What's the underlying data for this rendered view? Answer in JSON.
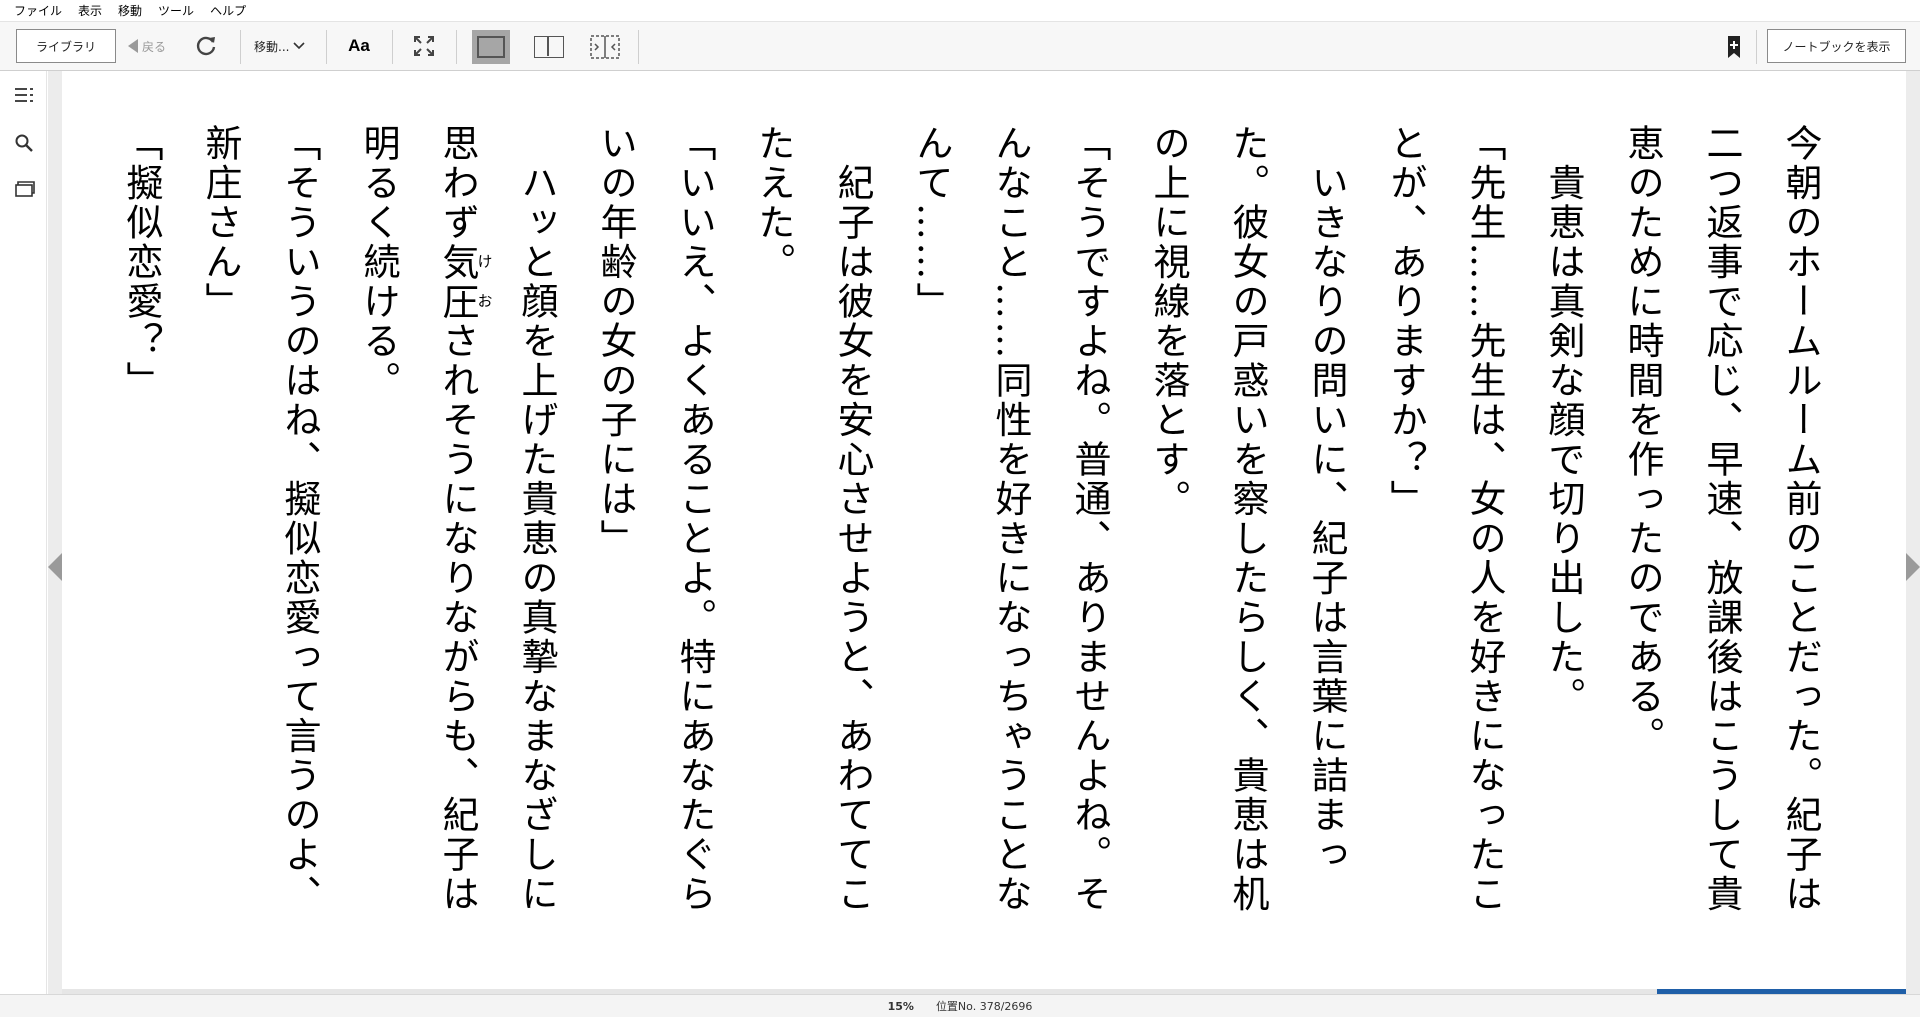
{
  "menu": [
    "ファイル",
    "表示",
    "移動",
    "ツール",
    "ヘルプ"
  ],
  "toolbar": {
    "library_label": "ライブラリ",
    "back_label": "戻る",
    "goto_label": "移動...",
    "font_label": "Aa",
    "notebook_label": "ノートブックを表示"
  },
  "book": {
    "paragraphs": [
      "今朝のホームルーム前のことだった。紀子は二つ返事で応じ、早速、放課後はこうして貴恵のために時間を作ったのである。",
      "　貴恵は真剣な顔で切り出した。",
      "「先生……先生は、女の人を好きになったことが、ありますか？」",
      "　いきなりの問いに、紀子は言葉に詰まった。彼女の戸惑いを察したらしく、貴恵は机の上に視線を落とす。",
      "「そうですよね。普通、ありませんよね。そんなこと……同性を好きになっちゃうことなんて……」",
      "　紀子は彼女を安心させようと、あわててこたえた。",
      "「いいえ、よくあることよ。特にあなたぐらいの年齢の女の子には」",
      "　ハッと顔を上げた貴恵の真摯なまなざしに思わず{気圧|けお}されそうになりながらも、紀子は明るく続ける。",
      "「そういうのはね、擬似恋愛って言うのよ、新庄さん」",
      "「擬似恋愛？」"
    ]
  },
  "status": {
    "percent": "15%",
    "location": "位置No. 378/2696",
    "progress": 0.15
  },
  "colors": {
    "progress_fill": "#1f5fa8",
    "toolbar_bg": "#f7f7f7",
    "active_view_bg": "#a6a6a6"
  }
}
